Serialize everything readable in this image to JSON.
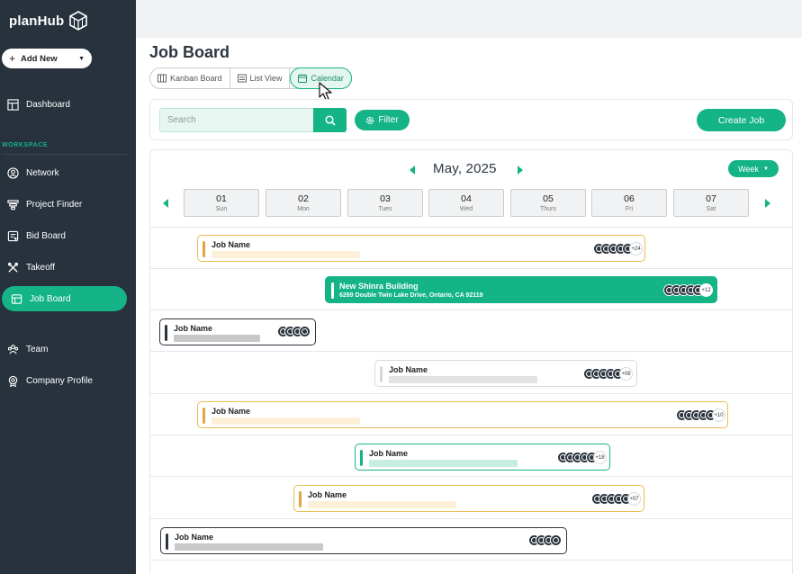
{
  "app": {
    "brand": "planHub"
  },
  "sidebar": {
    "add_new_label": "Add New",
    "workspace_label": "WORKSPACE",
    "items": [
      {
        "label": "Dashboard",
        "icon": "dashboard-icon"
      },
      {
        "label": "Network",
        "icon": "user-circle-icon"
      },
      {
        "label": "Project Finder",
        "icon": "funnel-icon"
      },
      {
        "label": "Bid Board",
        "icon": "bid-board-icon"
      },
      {
        "label": "Takeoff",
        "icon": "takeoff-icon"
      },
      {
        "label": "Job Board",
        "icon": "job-board-icon",
        "active": true
      },
      {
        "label": "Team",
        "icon": "team-icon"
      },
      {
        "label": "Company Profile",
        "icon": "badge-icon"
      }
    ]
  },
  "page": {
    "title": "Job Board",
    "view_tabs": [
      {
        "label": "Kanban Board"
      },
      {
        "label": "List View"
      },
      {
        "label": "Calendar",
        "active": true
      }
    ]
  },
  "toolbar": {
    "search_placeholder": "Search",
    "filter_label": "Filter",
    "create_label": "Create Job"
  },
  "calendar": {
    "month_label": "May, 2025",
    "view_label": "Week",
    "days": [
      {
        "num": "01",
        "name": "Sun"
      },
      {
        "num": "02",
        "name": "Mon"
      },
      {
        "num": "03",
        "name": "Tues"
      },
      {
        "num": "04",
        "name": "Wed"
      },
      {
        "num": "05",
        "name": "Thurs"
      },
      {
        "num": "06",
        "name": "Fri"
      },
      {
        "num": "07",
        "name": "Sat"
      }
    ],
    "jobs": [
      {
        "name": "Job Name",
        "more": "+24"
      },
      {
        "name": "New Shinra Building",
        "address": "6269 Double Twin Lake Drive, Ontario, CA 92119",
        "more": "+12"
      },
      {
        "name": "Job Name",
        "more": ""
      },
      {
        "name": "Job Name",
        "more": "+08"
      },
      {
        "name": "Job Name",
        "more": "+10"
      },
      {
        "name": "Job Name",
        "more": "+18"
      },
      {
        "name": "Job Name",
        "more": "+07"
      },
      {
        "name": "Job Name",
        "more": ""
      }
    ]
  },
  "colors": {
    "accent": "#14b486",
    "sidebar_bg": "#27323d",
    "job_yellow": "#e2a53d",
    "job_dark": "#2d3640"
  }
}
